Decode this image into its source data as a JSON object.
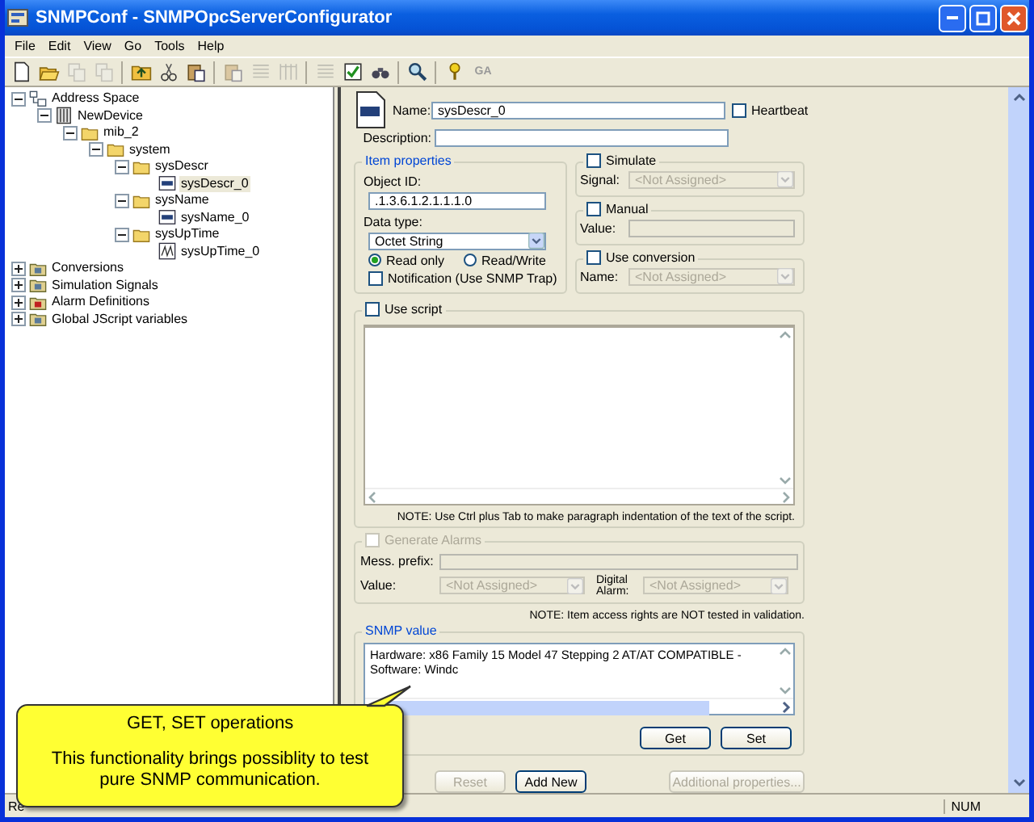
{
  "window": {
    "title": "SNMPConf - SNMPOpcServerConfigurator"
  },
  "menu": [
    "File",
    "Edit",
    "View",
    "Go",
    "Tools",
    "Help"
  ],
  "toolbar": [
    {
      "kind": "new",
      "disabled": false
    },
    {
      "kind": "open",
      "disabled": false
    },
    {
      "kind": "copy",
      "disabled": true
    },
    {
      "kind": "copy",
      "disabled": true
    },
    {
      "kind": "sep"
    },
    {
      "kind": "folder-up",
      "disabled": false
    },
    {
      "kind": "cut",
      "disabled": false
    },
    {
      "kind": "paste",
      "disabled": false
    },
    {
      "kind": "sep"
    },
    {
      "kind": "paste",
      "disabled": true
    },
    {
      "kind": "list",
      "disabled": true
    },
    {
      "kind": "grid",
      "disabled": true
    },
    {
      "kind": "sep"
    },
    {
      "kind": "list",
      "disabled": true
    },
    {
      "kind": "check",
      "disabled": false
    },
    {
      "kind": "binoculars",
      "disabled": false
    },
    {
      "kind": "sep"
    },
    {
      "kind": "magnifier",
      "disabled": false
    },
    {
      "kind": "sep"
    },
    {
      "kind": "help",
      "disabled": false
    },
    {
      "kind": "text",
      "label": "GA",
      "disabled": true
    }
  ],
  "tree": [
    {
      "label": "Address Space",
      "kind": "root",
      "expanded": true,
      "selected": false,
      "children": [
        {
          "label": "NewDevice",
          "kind": "device",
          "expanded": true,
          "selected": false,
          "children": [
            {
              "label": "mib_2",
              "kind": "folder",
              "expanded": true,
              "selected": false,
              "children": [
                {
                  "label": "system",
                  "kind": "folder",
                  "expanded": true,
                  "selected": false,
                  "children": [
                    {
                      "label": "sysDescr",
                      "kind": "folder",
                      "expanded": true,
                      "selected": false,
                      "children": [
                        {
                          "label": "sysDescr_0",
                          "kind": "tag",
                          "selected": true
                        }
                      ]
                    },
                    {
                      "label": "sysName",
                      "kind": "folder",
                      "expanded": true,
                      "selected": false,
                      "children": [
                        {
                          "label": "sysName_0",
                          "kind": "tag",
                          "selected": false
                        }
                      ]
                    },
                    {
                      "label": "sysUpTime",
                      "kind": "folder",
                      "expanded": true,
                      "selected": false,
                      "children": [
                        {
                          "label": "sysUpTime_0",
                          "kind": "wave",
                          "selected": false
                        }
                      ]
                    }
                  ]
                }
              ]
            }
          ]
        }
      ]
    },
    {
      "label": "Conversions",
      "kind": "group",
      "expanded": false,
      "selected": false
    },
    {
      "label": "Simulation Signals",
      "kind": "group",
      "expanded": false,
      "selected": false
    },
    {
      "label": "Alarm Definitions",
      "kind": "alarm",
      "expanded": false,
      "selected": false
    },
    {
      "label": "Global JScript variables",
      "kind": "group",
      "expanded": false,
      "selected": false
    }
  ],
  "form": {
    "name": {
      "label": "Name:",
      "value": "sysDescr_0"
    },
    "heartbeat": {
      "label": "Heartbeat",
      "checked": false
    },
    "description": {
      "label": "Description:"
    },
    "item_properties": {
      "title": "Item properties",
      "object_id_label": "Object ID:",
      "object_id": ".1.3.6.1.2.1.1.1.0",
      "data_type_label": "Data type:",
      "data_type": "Octet String",
      "access": [
        {
          "label": "Read only",
          "selected": true
        },
        {
          "label": "Read/Write",
          "selected": false
        }
      ],
      "notification": {
        "label": "Notification (Use SNMP Trap)",
        "checked": false
      }
    },
    "simulate": {
      "label": "Simulate",
      "checked": false,
      "signal_label": "Signal:",
      "signal": "<Not Assigned>"
    },
    "manual": {
      "label": "Manual",
      "checked": false,
      "value_label": "Value:"
    },
    "use_conversion": {
      "label": "Use conversion",
      "checked": false,
      "name_label": "Name:",
      "name": "<Not Assigned>"
    },
    "use_script": {
      "label": "Use script",
      "checked": false,
      "note": "NOTE: Use Ctrl plus Tab to make paragraph indentation of the text of the script."
    },
    "generate_alarms": {
      "label": "Generate Alarms",
      "checked": false,
      "disabled": true,
      "prefix_label": "Mess. prefix:",
      "value_label": "Value:",
      "value": "<Not Assigned>",
      "digital_label": "Digital Alarm:",
      "digital": "<Not Assigned>"
    },
    "access_note": "NOTE: Item access rights are NOT tested in validation.",
    "snmp_value": {
      "title": "SNMP value",
      "value": "Hardware: x86 Family 15 Model 47 Stepping 2 AT/AT COMPATIBLE - Software: Windc",
      "buttons": [
        {
          "label": "Get",
          "disabled": false
        },
        {
          "label": "Set",
          "disabled": false
        }
      ]
    },
    "buttons": [
      {
        "label": "Reset",
        "disabled": true
      },
      {
        "label": "Add New",
        "disabled": false
      },
      {
        "label": "Additional properties...",
        "disabled": true
      }
    ]
  },
  "status_bar": {
    "text": "Re",
    "num": "NUM"
  },
  "callout": {
    "title": "GET, SET operations",
    "text": "This functionality brings possiblity to test pure SNMP communication."
  }
}
